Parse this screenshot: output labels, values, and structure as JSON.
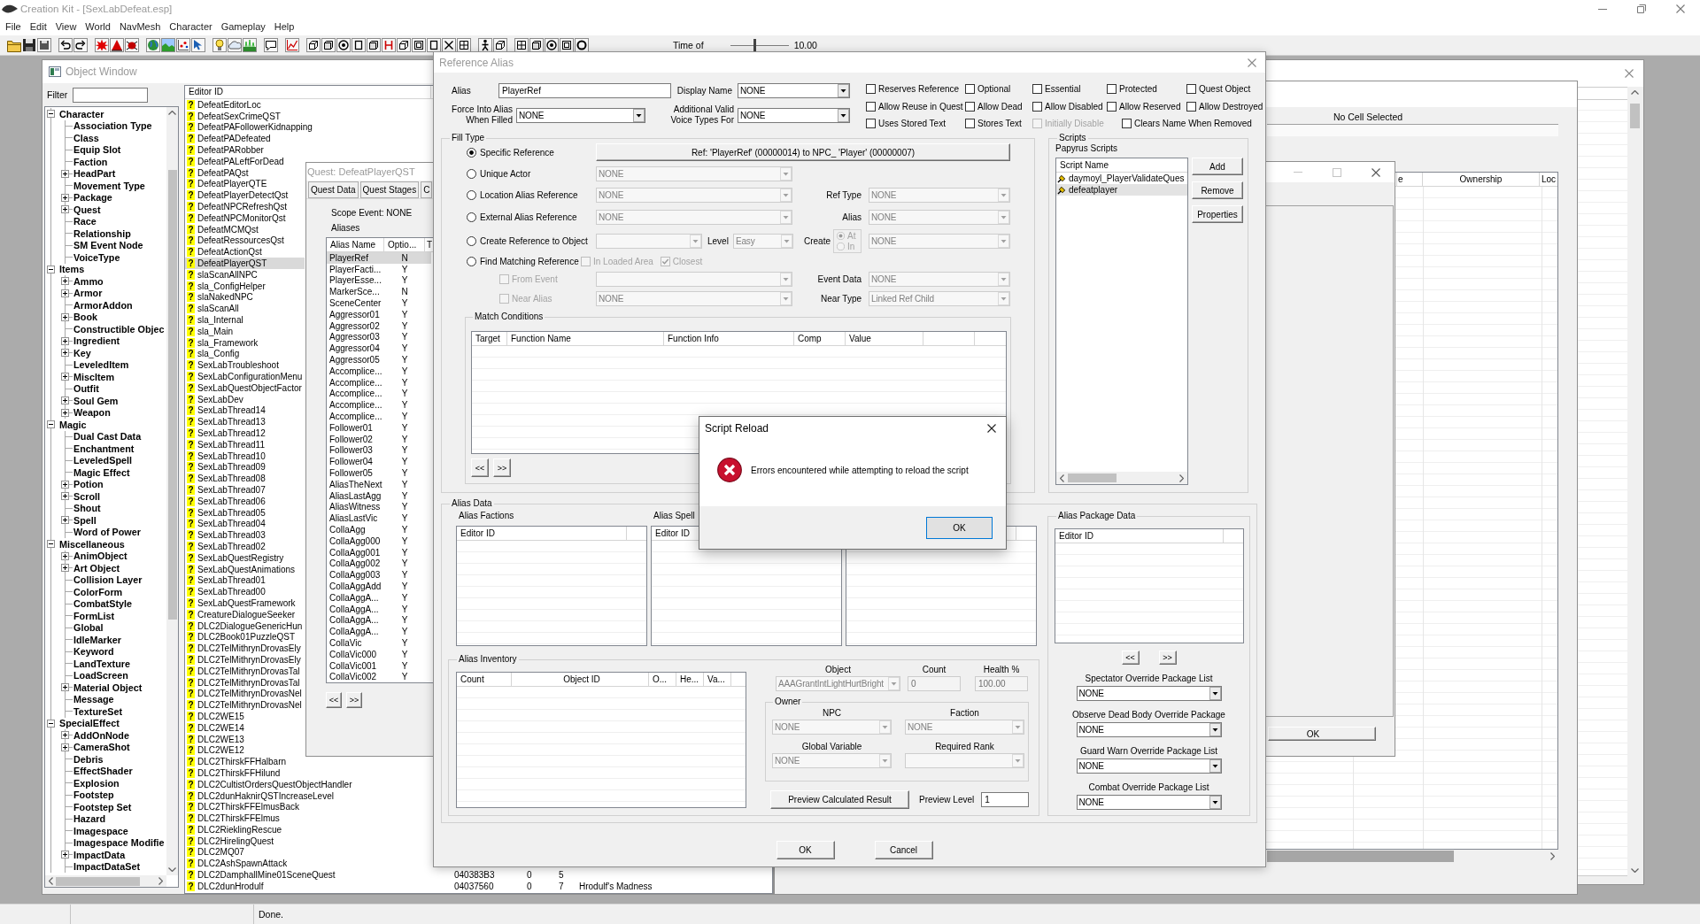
{
  "app": {
    "title": "Creation Kit - [SexLabDefeat.esp]",
    "menu": [
      "File",
      "Edit",
      "View",
      "World",
      "NavMesh",
      "Character",
      "Gameplay",
      "Help"
    ],
    "time_label": "Time of",
    "time_slider": {
      "level": 0.42
    },
    "time_value": "10.00"
  },
  "object_window": {
    "title": "Object Window",
    "filter_label": "Filter",
    "tree": [
      {
        "label": "Character",
        "expanded": true,
        "children": [
          {
            "label": "Association Type"
          },
          {
            "label": "Class"
          },
          {
            "label": "Equip Slot"
          },
          {
            "label": "Faction"
          },
          {
            "label": "HeadPart",
            "expanded": false
          },
          {
            "label": "Movement Type"
          },
          {
            "label": "Package",
            "expanded": false
          },
          {
            "label": "Quest",
            "expanded": false
          },
          {
            "label": "Race"
          },
          {
            "label": "Relationship"
          },
          {
            "label": "SM Event Node"
          },
          {
            "label": "VoiceType"
          }
        ]
      },
      {
        "label": "Items",
        "expanded": true,
        "children": [
          {
            "label": "Ammo",
            "expanded": false
          },
          {
            "label": "Armor",
            "expanded": false
          },
          {
            "label": "ArmorAddon"
          },
          {
            "label": "Book",
            "expanded": false
          },
          {
            "label": "Constructible Objec"
          },
          {
            "label": "Ingredient",
            "expanded": false
          },
          {
            "label": "Key",
            "expanded": false
          },
          {
            "label": "LeveledItem"
          },
          {
            "label": "MiscItem",
            "expanded": false
          },
          {
            "label": "Outfit"
          },
          {
            "label": "Soul Gem",
            "expanded": false
          },
          {
            "label": "Weapon",
            "expanded": false
          }
        ]
      },
      {
        "label": "Magic",
        "expanded": true,
        "children": [
          {
            "label": "Dual Cast Data"
          },
          {
            "label": "Enchantment"
          },
          {
            "label": "LeveledSpell"
          },
          {
            "label": "Magic Effect"
          },
          {
            "label": "Potion",
            "expanded": false
          },
          {
            "label": "Scroll",
            "expanded": false
          },
          {
            "label": "Shout"
          },
          {
            "label": "Spell",
            "expanded": false
          },
          {
            "label": "Word of Power"
          }
        ]
      },
      {
        "label": "Miscellaneous",
        "expanded": true,
        "children": [
          {
            "label": "AnimObject",
            "expanded": false
          },
          {
            "label": "Art Object",
            "expanded": false
          },
          {
            "label": "Collision Layer"
          },
          {
            "label": "ColorForm"
          },
          {
            "label": "CombatStyle"
          },
          {
            "label": "FormList"
          },
          {
            "label": "Global"
          },
          {
            "label": "IdleMarker"
          },
          {
            "label": "Keyword"
          },
          {
            "label": "LandTexture"
          },
          {
            "label": "LoadScreen"
          },
          {
            "label": "Material Object",
            "expanded": false
          },
          {
            "label": "Message"
          },
          {
            "label": "TextureSet"
          }
        ]
      },
      {
        "label": "SpecialEffect",
        "expanded": true,
        "children": [
          {
            "label": "AddOnNode",
            "expanded": false
          },
          {
            "label": "CameraShot",
            "expanded": false
          },
          {
            "label": "Debris"
          },
          {
            "label": "EffectShader"
          },
          {
            "label": "Explosion"
          },
          {
            "label": "Footstep"
          },
          {
            "label": "Footstep Set"
          },
          {
            "label": "Hazard"
          },
          {
            "label": "Imagespace"
          },
          {
            "label": "Imagespace Modifie"
          },
          {
            "label": "ImpactData",
            "expanded": false
          },
          {
            "label": "ImpactDataSet"
          }
        ]
      }
    ],
    "columns": [
      "Editor ID"
    ],
    "rows": [
      {
        "badge": "?",
        "editor_id": "DefeatEditorLoc",
        "selected": false
      },
      {
        "badge": "?",
        "editor_id": "DefeatSexCrimeQST",
        "selected": false
      },
      {
        "badge": "?",
        "editor_id": "DefeatPAFollowerKidnapping",
        "selected": false
      },
      {
        "badge": "?",
        "editor_id": "DefeatPADefeated",
        "selected": false
      },
      {
        "badge": "?",
        "editor_id": "DefeatPARobber",
        "selected": false
      },
      {
        "badge": "?",
        "editor_id": "DefeatPALeftForDead",
        "selected": false
      },
      {
        "badge": "?",
        "editor_id": "DefeatPAQst",
        "selected": false
      },
      {
        "badge": "?",
        "editor_id": "DefeatPlayerQTE",
        "selected": false
      },
      {
        "badge": "?",
        "editor_id": "DefeatPlayerDetectQst",
        "selected": false
      },
      {
        "badge": "?",
        "editor_id": "DefeatNPCRefreshQst",
        "selected": false
      },
      {
        "badge": "?",
        "editor_id": "DefeatNPCMonitorQst",
        "selected": false
      },
      {
        "badge": "?",
        "editor_id": "DefeatMCMQst",
        "selected": false
      },
      {
        "badge": "?",
        "editor_id": "DefeatRessourcesQst",
        "selected": false
      },
      {
        "badge": "?",
        "editor_id": "DefeatActionQst",
        "selected": false
      },
      {
        "badge": "?",
        "editor_id": "DefeatPlayerQST",
        "selected": true
      },
      {
        "badge": "?",
        "editor_id": "slaScanAllNPC",
        "selected": false
      },
      {
        "badge": "?",
        "editor_id": "sla_ConfigHelper",
        "selected": false
      },
      {
        "badge": "?",
        "editor_id": "slaNakedNPC",
        "selected": false
      },
      {
        "badge": "?",
        "editor_id": "slaScanAll",
        "selected": false
      },
      {
        "badge": "?",
        "editor_id": "sla_Internal",
        "selected": false
      },
      {
        "badge": "?",
        "editor_id": "sla_Main",
        "selected": false
      },
      {
        "badge": "?",
        "editor_id": "sla_Framework",
        "selected": false
      },
      {
        "badge": "?",
        "editor_id": "sla_Config",
        "selected": false
      },
      {
        "badge": "?",
        "editor_id": "SexLabTroubleshoot",
        "selected": false
      },
      {
        "badge": "?",
        "editor_id": "SexLabConfigurationMenu",
        "selected": false
      },
      {
        "badge": "?",
        "editor_id": "SexLabQuestObjectFactor",
        "selected": false
      },
      {
        "badge": "?",
        "editor_id": "SexLabDev",
        "selected": false
      },
      {
        "badge": "?",
        "editor_id": "SexLabThread14",
        "selected": false
      },
      {
        "badge": "?",
        "editor_id": "SexLabThread13",
        "selected": false
      },
      {
        "badge": "?",
        "editor_id": "SexLabThread12",
        "selected": false
      },
      {
        "badge": "?",
        "editor_id": "SexLabThread11",
        "selected": false
      },
      {
        "badge": "?",
        "editor_id": "SexLabThread10",
        "selected": false
      },
      {
        "badge": "?",
        "editor_id": "SexLabThread09",
        "selected": false
      },
      {
        "badge": "?",
        "editor_id": "SexLabThread08",
        "selected": false
      },
      {
        "badge": "?",
        "editor_id": "SexLabThread07",
        "selected": false
      },
      {
        "badge": "?",
        "editor_id": "SexLabThread06",
        "selected": false
      },
      {
        "badge": "?",
        "editor_id": "SexLabThread05",
        "selected": false
      },
      {
        "badge": "?",
        "editor_id": "SexLabThread04",
        "selected": false
      },
      {
        "badge": "?",
        "editor_id": "SexLabThread03",
        "selected": false
      },
      {
        "badge": "?",
        "editor_id": "SexLabThread02",
        "selected": false
      },
      {
        "badge": "?",
        "editor_id": "SexLabQuestRegistry",
        "selected": false
      },
      {
        "badge": "?",
        "editor_id": "SexLabQuestAnimations",
        "selected": false
      },
      {
        "badge": "?",
        "editor_id": "SexLabThread01",
        "selected": false
      },
      {
        "badge": "?",
        "editor_id": "SexLabThread00",
        "selected": false
      },
      {
        "badge": "?",
        "editor_id": "SexLabQuestFramework",
        "selected": false
      },
      {
        "badge": "?",
        "editor_id": "CreatureDialogueSeeker",
        "selected": false
      },
      {
        "badge": "?",
        "editor_id": "DLC2DialogueGenericHun",
        "selected": false
      },
      {
        "badge": "?",
        "editor_id": "DLC2Book01PuzzleQST",
        "selected": false
      },
      {
        "badge": "?",
        "editor_id": "DLC2TelMithrynDrovasEly",
        "selected": false
      },
      {
        "badge": "?",
        "editor_id": "DLC2TelMithrynDrovasEly",
        "selected": false
      },
      {
        "badge": "?",
        "editor_id": "DLC2TelMithrynDrovasTal",
        "selected": false
      },
      {
        "badge": "?",
        "editor_id": "DLC2TelMithrynDrovasTal",
        "selected": false
      },
      {
        "badge": "?",
        "editor_id": "DLC2TelMithrynDrovasNel",
        "selected": false
      },
      {
        "badge": "?",
        "editor_id": "DLC2TelMithrynDrovasNel",
        "selected": false
      },
      {
        "badge": "?",
        "editor_id": "DLC2WE15",
        "selected": false
      },
      {
        "badge": "?",
        "editor_id": "DLC2WE14",
        "selected": false
      },
      {
        "badge": "?",
        "editor_id": "DLC2WE13",
        "selected": false
      },
      {
        "badge": "?",
        "editor_id": "DLC2WE12",
        "selected": false
      },
      {
        "badge": "?",
        "editor_id": "DLC2ThirskFFHalbarn",
        "selected": false
      },
      {
        "badge": "?",
        "editor_id": "DLC2ThirskFFHilund",
        "selected": false
      },
      {
        "badge": "?",
        "editor_id": "DLC2CultistOrdersQuestObjectHandler",
        "selected": false
      },
      {
        "badge": "?",
        "editor_id": "DLC2dunHaknirQSTIncreaseLevel",
        "selected": false
      },
      {
        "badge": "?",
        "editor_id": "DLC2ThirskFFElmusBack",
        "selected": false
      },
      {
        "badge": "?",
        "editor_id": "DLC2ThirskFFElmus",
        "selected": false
      },
      {
        "badge": "?",
        "editor_id": "DLC2RieklingRescue",
        "selected": false
      },
      {
        "badge": "?",
        "editor_id": "DLC2HirelingQuest",
        "selected": false
      },
      {
        "badge": "?",
        "editor_id": "DLC2MQ07",
        "selected": false
      },
      {
        "badge": "?",
        "editor_id": "DLC2AshSpawnAttack",
        "selected": false
      },
      {
        "badge": "?",
        "editor_id": "DLC2DamphallMine01SceneQuest",
        "selected": false,
        "cells": [
          "040383B3",
          "0",
          "5"
        ]
      },
      {
        "badge": "?",
        "editor_id": "DLC2dunHrodulf",
        "selected": false,
        "cells": [
          "04037560",
          "0",
          "7",
          "Hrodulf's Madness"
        ]
      }
    ]
  },
  "quest_window": {
    "title": "Quest: DefeatPlayerQST",
    "tabs": [
      {
        "label": "Quest Data",
        "selected": false
      },
      {
        "label": "Quest Stages",
        "selected": false
      },
      {
        "label": "C",
        "selected": false
      }
    ],
    "scope_event": "Scope Event: NONE",
    "aliases_label": "Aliases",
    "columns": [
      "Alias Name",
      "Optio...",
      "T"
    ],
    "rows": [
      {
        "name": "PlayerRef",
        "optional": "N",
        "selected": true
      },
      {
        "name": "PlayerFacti...",
        "optional": "Y",
        "selected": false
      },
      {
        "name": "PlayerEsse...",
        "optional": "Y",
        "selected": false
      },
      {
        "name": "MarkerSce...",
        "optional": "N",
        "selected": false
      },
      {
        "name": "SceneCenter",
        "optional": "Y",
        "selected": false
      },
      {
        "name": "Aggressor01",
        "optional": "Y",
        "selected": false
      },
      {
        "name": "Aggressor02",
        "optional": "Y",
        "selected": false
      },
      {
        "name": "Aggressor03",
        "optional": "Y",
        "selected": false
      },
      {
        "name": "Aggressor04",
        "optional": "Y",
        "selected": false
      },
      {
        "name": "Aggressor05",
        "optional": "Y",
        "selected": false
      },
      {
        "name": "Accomplice...",
        "optional": "Y",
        "selected": false
      },
      {
        "name": "Accomplice...",
        "optional": "Y",
        "selected": false
      },
      {
        "name": "Accomplice...",
        "optional": "Y",
        "selected": false
      },
      {
        "name": "Accomplice...",
        "optional": "Y",
        "selected": false
      },
      {
        "name": "Accomplice...",
        "optional": "Y",
        "selected": false
      },
      {
        "name": "Follower01",
        "optional": "Y",
        "selected": false
      },
      {
        "name": "Follower02",
        "optional": "Y",
        "selected": false
      },
      {
        "name": "Follower03",
        "optional": "Y",
        "selected": false
      },
      {
        "name": "Follower04",
        "optional": "Y",
        "selected": false
      },
      {
        "name": "Follower05",
        "optional": "Y",
        "selected": false
      },
      {
        "name": "AliasTheNext",
        "optional": "Y",
        "selected": false
      },
      {
        "name": "AliasLastAgg",
        "optional": "Y",
        "selected": false
      },
      {
        "name": "AliasWitness",
        "optional": "Y",
        "selected": false
      },
      {
        "name": "AliasLastVic",
        "optional": "Y",
        "selected": false
      },
      {
        "name": "CollaAgg",
        "optional": "Y",
        "selected": false
      },
      {
        "name": "CollaAgg000",
        "optional": "Y",
        "selected": false
      },
      {
        "name": "CollaAgg001",
        "optional": "Y",
        "selected": false
      },
      {
        "name": "CollaAgg002",
        "optional": "Y",
        "selected": false
      },
      {
        "name": "CollaAgg003",
        "optional": "Y",
        "selected": false
      },
      {
        "name": "CollaAggAdd",
        "optional": "Y",
        "selected": false
      },
      {
        "name": "CollaAggA...",
        "optional": "Y",
        "selected": false
      },
      {
        "name": "CollaAggA...",
        "optional": "Y",
        "selected": false
      },
      {
        "name": "CollaAggA...",
        "optional": "Y",
        "selected": false
      },
      {
        "name": "CollaAggA...",
        "optional": "Y",
        "selected": false
      },
      {
        "name": "CollaVic",
        "optional": "Y",
        "selected": false
      },
      {
        "name": "CollaVic000",
        "optional": "Y",
        "selected": false
      },
      {
        "name": "CollaVic001",
        "optional": "Y",
        "selected": false
      },
      {
        "name": "CollaVic002",
        "optional": "Y",
        "selected": false
      }
    ],
    "prev_button": "<<",
    "next_button": ">>"
  },
  "reference_alias": {
    "title": "Reference Alias",
    "alias": {
      "label": "Alias",
      "value": "PlayerRef",
      "disabled": false
    },
    "display_name": {
      "label": "Display Name",
      "value": "NONE",
      "disabled": false
    },
    "force_into_alias": {
      "label": "Force Into Alias When Filled",
      "value": "NONE",
      "disabled": false
    },
    "voice_types": {
      "label": "Additional Valid Voice Types For",
      "value": "NONE",
      "disabled": false
    },
    "flags": [
      {
        "label": "Reserves Reference",
        "checked": false,
        "disabled": false
      },
      {
        "label": "Optional",
        "checked": false,
        "disabled": false
      },
      {
        "label": "Essential",
        "checked": false,
        "disabled": false
      },
      {
        "label": "Protected",
        "checked": false,
        "disabled": false
      },
      {
        "label": "Quest Object",
        "checked": false,
        "disabled": false
      },
      {
        "label": "Allow Reuse in Quest",
        "checked": false,
        "disabled": false
      },
      {
        "label": "Allow Dead",
        "checked": false,
        "disabled": false
      },
      {
        "label": "Allow Disabled",
        "checked": false,
        "disabled": false
      },
      {
        "label": "Allow Reserved",
        "checked": false,
        "disabled": false
      },
      {
        "label": "Allow Destroyed",
        "checked": false,
        "disabled": false
      },
      {
        "label": "Uses Stored Text",
        "checked": false,
        "disabled": false
      },
      {
        "label": "Stores Text",
        "checked": false,
        "disabled": false
      },
      {
        "label": "Initially Disable",
        "checked": false,
        "disabled": true
      },
      {
        "label": "Clears Name When Removed",
        "checked": false,
        "disabled": false
      }
    ],
    "fill_type": {
      "title": "Fill Type",
      "options": [
        {
          "label": "Specific Reference",
          "selected": true
        },
        {
          "label": "Unique Actor",
          "selected": false
        },
        {
          "label": "Location Alias Reference",
          "selected": false
        },
        {
          "label": "External Alias Reference",
          "selected": false
        },
        {
          "label": "Create Reference to Object",
          "selected": false
        },
        {
          "label": "Find Matching Reference",
          "selected": false
        }
      ],
      "ref_button": "Ref: 'PlayerRef' (00000014) to NPC_ 'Player' (00000007)",
      "unique_actor": {
        "value": "NONE",
        "disabled": true
      },
      "location_alias": {
        "value": "NONE",
        "disabled": true
      },
      "ref_type": {
        "label": "Ref Type",
        "value": "NONE",
        "disabled": true
      },
      "external_alias": {
        "value": "NONE",
        "disabled": true
      },
      "alias": {
        "label": "Alias",
        "value": "NONE",
        "disabled": true
      },
      "create_object": {
        "disabled": true
      },
      "level": {
        "label": "Level",
        "value": "Easy",
        "disabled": true
      },
      "create": {
        "label": "Create",
        "options": [
          {
            "label": "At",
            "selected": true,
            "disabled": true
          },
          {
            "label": "In",
            "selected": false,
            "disabled": true
          }
        ]
      },
      "create_target": {
        "value": "NONE",
        "disabled": true
      },
      "in_loaded_area": {
        "label": "In Loaded Area",
        "checked": false,
        "disabled": true
      },
      "closest": {
        "label": "Closest",
        "checked": true,
        "disabled": true
      },
      "from_event": {
        "label": "From Event",
        "checked": false,
        "disabled": true
      },
      "event": {
        "disabled": true
      },
      "event_data": {
        "label": "Event Data",
        "value": "NONE",
        "disabled": true
      },
      "near_alias": {
        "label": "Near Alias",
        "checked": false,
        "disabled": true
      },
      "near_alias_value": {
        "value": "NONE",
        "disabled": true
      },
      "near_type": {
        "label": "Near Type",
        "value": "Linked Ref Child",
        "disabled": true
      },
      "match_conditions": {
        "title": "Match Conditions",
        "columns": [
          "Target",
          "Function Name",
          "Function Info",
          "Comp",
          "Value"
        ],
        "prev_button": "<<",
        "next_button": ">>"
      }
    },
    "scripts": {
      "title": "Scripts",
      "label": "Papyrus Scripts",
      "columns": [
        "Script Name"
      ],
      "rows": [
        {
          "name": "daymoyl_PlayerValidateQues",
          "selected": false
        },
        {
          "name": "defeatplayer",
          "selected": true
        }
      ],
      "buttons": [
        "Add",
        "Remove",
        "Properties"
      ]
    },
    "alias_data": {
      "title": "Alias Data",
      "factions": {
        "label": "Alias Factions",
        "columns": [
          "Editor ID"
        ]
      },
      "spells": {
        "label": "Alias Spell",
        "columns": [
          "Editor ID"
        ]
      },
      "inventory": {
        "title": "Alias Inventory",
        "columns": [
          "Count",
          "Object ID",
          "O...",
          "He...",
          "Va..."
        ],
        "object": {
          "label": "Object",
          "value": "AAAGrantIntLightHurtBright",
          "disabled": true
        },
        "count": {
          "label": "Count",
          "value": "0",
          "disabled": true
        },
        "health": {
          "label": "Health %",
          "value": "100.00",
          "disabled": true
        },
        "owner": {
          "title": "Owner",
          "npc": {
            "label": "NPC",
            "value": "NONE",
            "disabled": true
          },
          "faction": {
            "label": "Faction",
            "value": "NONE",
            "disabled": true
          },
          "global_variable": {
            "label": "Global Variable",
            "value": "NONE",
            "disabled": true
          },
          "required_rank": {
            "label": "Required Rank",
            "disabled": true
          }
        },
        "preview_button": "Preview Calculated Result",
        "preview_level": {
          "label": "Preview Level",
          "value": "1",
          "disabled": false
        }
      },
      "package_data": {
        "title": "Alias Package Data",
        "columns": [
          "Editor ID"
        ],
        "prev_button": "<<",
        "next_button": ">>",
        "overrides": [
          {
            "label": "Spectator Override Package List",
            "value": "NONE",
            "disabled": false
          },
          {
            "label": "Observe Dead Body Override Package",
            "value": "NONE",
            "disabled": false
          },
          {
            "label": "Guard Warn Override Package List",
            "value": "NONE",
            "disabled": false
          },
          {
            "label": "Combat Override Package List",
            "value": "NONE",
            "disabled": false
          }
        ]
      }
    },
    "buttons": [
      "OK",
      "Cancel"
    ]
  },
  "script_reload": {
    "title": "Script Reload",
    "message": "Errors encountered while attempting to reload the script",
    "button": "OK"
  },
  "cell_view": {
    "status": "No Cell Selected",
    "columns": [
      "e",
      "Ownership",
      "Loc"
    ]
  },
  "small_window": {
    "button": "OK"
  },
  "status_bar": {
    "text": "Done."
  }
}
